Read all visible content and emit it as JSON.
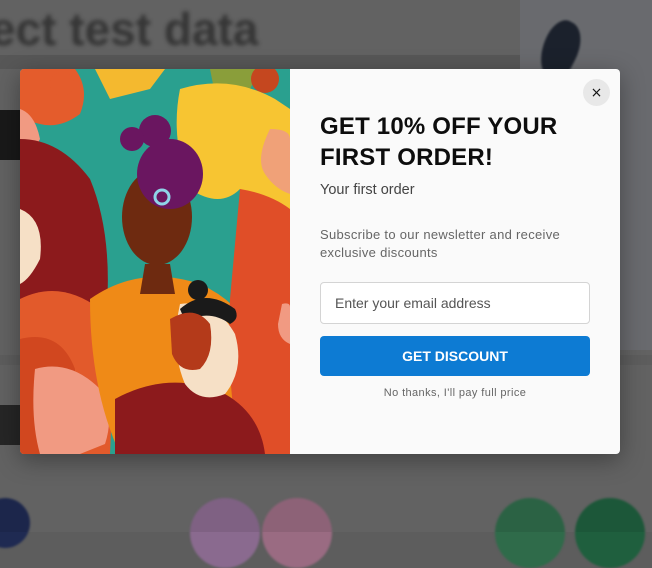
{
  "background_page": {
    "heading": "ect test data"
  },
  "modal": {
    "close_label": "×",
    "title": "GET 10% OFF YOUR FIRST ORDER!",
    "subtitle": "Your first order",
    "description": "Subscribe to our newsletter and receive exclusive discounts",
    "email": {
      "value": "",
      "placeholder": "Enter your email address"
    },
    "submit_label": "GET DISCOUNT",
    "decline_label": "No thanks, I'll pay full price"
  },
  "colors": {
    "primary_button": "#0d7bd3",
    "modal_background": "#fafafa"
  },
  "icons": {
    "close": "close-icon"
  }
}
